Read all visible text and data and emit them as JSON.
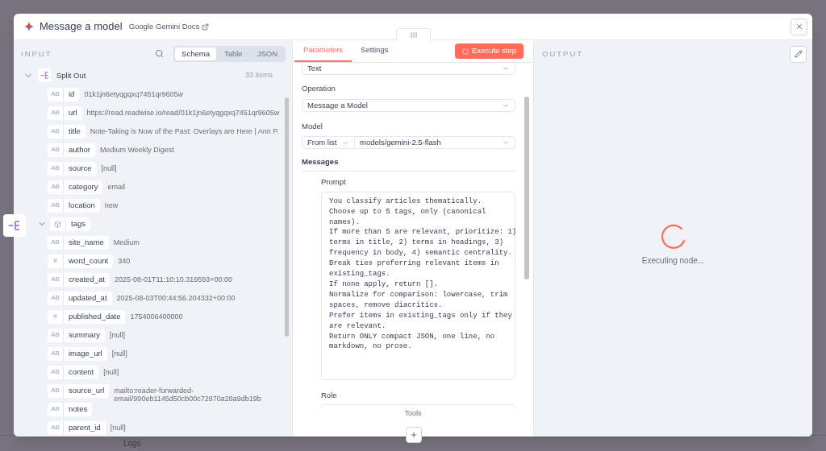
{
  "background": {
    "logs_label": "Logs"
  },
  "header": {
    "title": "Message a model",
    "docs_link": "Google Gemini Docs"
  },
  "input": {
    "label": "INPUT",
    "view_tabs": [
      {
        "label": "Schema",
        "selected": true
      },
      {
        "label": "Table",
        "selected": false
      },
      {
        "label": "JSON",
        "selected": false
      }
    ],
    "node": {
      "name": "Split Out",
      "count": "33 items",
      "expanded": true
    },
    "fields": [
      {
        "kind": "text",
        "type": "AB",
        "name": "id",
        "value": "01k1jn6etyqgqxq7451qr9605w"
      },
      {
        "kind": "text",
        "type": "AB",
        "name": "url",
        "value": "https://read.readwise.io/read/01k1jn6etyqgqxq7451qr9605w"
      },
      {
        "kind": "text",
        "type": "AB",
        "name": "title",
        "value": "Note-Taking is Now of the Past: Overlays are Here | Ann P."
      },
      {
        "kind": "text",
        "type": "AB",
        "name": "author",
        "value": "Medium Weekly Digest"
      },
      {
        "kind": "text",
        "type": "AB",
        "name": "source",
        "value": "[null]"
      },
      {
        "kind": "text",
        "type": "AB",
        "name": "category",
        "value": "email"
      },
      {
        "kind": "text",
        "type": "AB",
        "name": "location",
        "value": "new"
      },
      {
        "kind": "object",
        "name": "tags",
        "expanded": true
      },
      {
        "kind": "text",
        "type": "AB",
        "name": "site_name",
        "value": "Medium"
      },
      {
        "kind": "text",
        "type": "#",
        "name": "word_count",
        "value": "340"
      },
      {
        "kind": "text",
        "type": "AB",
        "name": "created_at",
        "value": "2025-08-01T11:10:10.319593+00:00"
      },
      {
        "kind": "text",
        "type": "AB",
        "name": "updated_at",
        "value": "2025-08-03T00:44:56.204332+00:00"
      },
      {
        "kind": "text",
        "type": "#",
        "name": "published_date",
        "value": "1754006400000"
      },
      {
        "kind": "text",
        "type": "AB",
        "name": "summary",
        "value": "[null]"
      },
      {
        "kind": "text",
        "type": "AB",
        "name": "image_url",
        "value": "[null]"
      },
      {
        "kind": "text",
        "type": "AB",
        "name": "content",
        "value": "[null]"
      },
      {
        "kind": "text",
        "type": "AB",
        "name": "source_url",
        "value": "mailto:reader-forwarded-email/990eb1145d50cb00c72870a28a9db19b"
      },
      {
        "kind": "text",
        "type": "AB",
        "name": "notes"
      },
      {
        "kind": "text",
        "type": "AB",
        "name": "parent_id",
        "value": "[null]"
      }
    ]
  },
  "parameters": {
    "tabs": [
      {
        "label": "Parameters",
        "selected": true
      },
      {
        "label": "Settings",
        "selected": false
      }
    ],
    "execute_button": "Execute step",
    "resource_value": "Text",
    "operation": {
      "label": "Operation",
      "value": "Message a Model"
    },
    "model": {
      "label": "Model",
      "mode": "From list",
      "value": "models/gemini-2.5-flash"
    },
    "messages": {
      "label": "Messages",
      "prompt_label": "Prompt",
      "prompt_lines": [
        "You classify articles thematically.",
        "Choose up to 5 tags, only (canonical",
        "names).",
        "If more than 5 are relevant, prioritize: 1)",
        "terms in title, 2) terms in headings, 3)",
        "frequency in body, 4) semantic centrality.",
        "Break ties preferring relevant items in",
        "existing_tags.",
        "If none apply, return [].",
        "Normalize for comparison: lowercase, trim",
        "spaces, remove diacritics.",
        "Prefer items in existing_tags only if they",
        "are relevant.",
        "Return ONLY compact JSON, one line, no",
        "markdown, no prose."
      ],
      "role_label": "Role"
    },
    "footer": "Tools"
  },
  "output": {
    "label": "OUTPUT",
    "status": "Executing node..."
  }
}
